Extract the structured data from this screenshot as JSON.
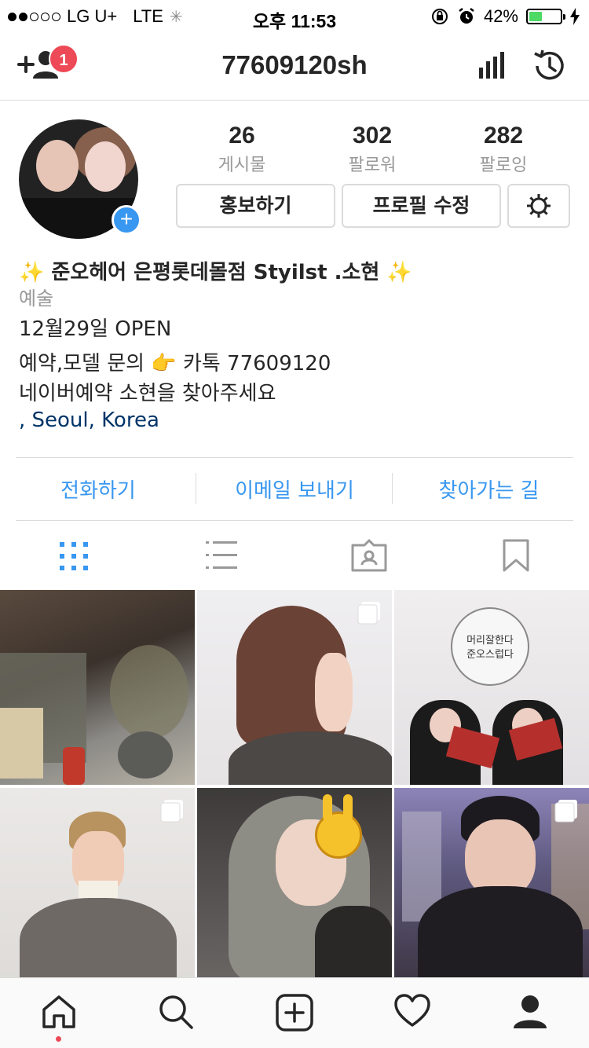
{
  "status_bar": {
    "carrier": "LG U+",
    "network": "LTE",
    "time": "오후 11:53",
    "battery": "42%",
    "battery_level": 0.42
  },
  "header": {
    "username": "77609120sh",
    "notification_count": "1"
  },
  "stats": [
    {
      "value": "26",
      "label": "게시물"
    },
    {
      "value": "302",
      "label": "팔로워"
    },
    {
      "value": "282",
      "label": "팔로잉"
    }
  ],
  "buttons": {
    "promote": "홍보하기",
    "edit_profile": "프로필 수정"
  },
  "bio": {
    "name": "✨ 준오헤어 은평롯데몰점 Styilst .소현 ✨",
    "category": "예술",
    "line1": "12월29일 OPEN",
    "line2": "예약,모델 문의 👉  카톡 77609120",
    "line3": "네이버예약 소현을 찾아주세요",
    "location": " , Seoul, Korea"
  },
  "contact": {
    "call": "전화하기",
    "email": "이메일 보내기",
    "directions": "찾아가는 길"
  },
  "grid_text": {
    "sign_line1": "머리잘한다",
    "sign_line2": "준오스럽다"
  },
  "colors": {
    "accent": "#3897f0",
    "badge": "#ed4956",
    "location_link": "#003569"
  },
  "icons": {
    "add_person": "add-person-icon",
    "insights": "bar-chart-icon",
    "archive": "history-icon",
    "settings": "gear-icon",
    "grid": "grid-icon",
    "list": "list-icon",
    "tagged": "tagged-icon",
    "saved": "bookmark-icon",
    "home": "home-icon",
    "search": "search-icon",
    "new_post": "plus-square-icon",
    "activity": "heart-icon",
    "profile": "person-icon"
  }
}
